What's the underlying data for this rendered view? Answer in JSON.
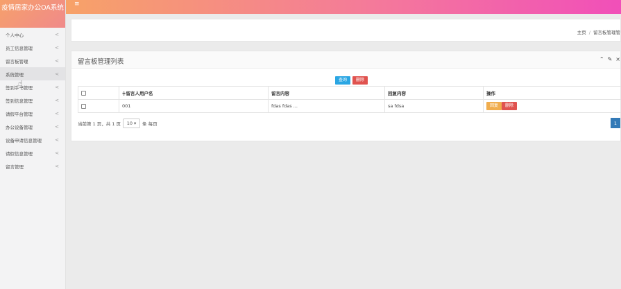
{
  "app": {
    "title": "疫情居家办公OA系统"
  },
  "sidebar": {
    "items": [
      {
        "label": "个人中心"
      },
      {
        "label": "员工信息管理"
      },
      {
        "label": "留言板管理"
      },
      {
        "label": "系统管理"
      },
      {
        "label": "签到手书管理"
      },
      {
        "label": "签到信息管理"
      },
      {
        "label": "请假平台管理"
      },
      {
        "label": "办公设备管理"
      },
      {
        "label": "设备申请信息管理"
      },
      {
        "label": "请假信息管理"
      },
      {
        "label": "留言管理"
      }
    ],
    "active_index": 3,
    "chevron": "<"
  },
  "topbar": {
    "menu_icon": "≡"
  },
  "breadcrumb": {
    "home": "主页",
    "sep": "/",
    "current": "留言板管理管"
  },
  "panel": {
    "title": "留言板管理列表",
    "tools": {
      "collapse": "⌃",
      "wrench": "✎",
      "close": "×"
    },
    "search_button": "查询",
    "delete_button": "删除"
  },
  "table": {
    "headers": [
      "≑留言人用户名",
      "留言内容",
      "回复内容",
      "操作"
    ],
    "rows": [
      {
        "username": "001",
        "content": "fdas fdas ...",
        "reply": "sa fdsa",
        "reply_btn": "回复",
        "delete_btn": "删除"
      }
    ]
  },
  "pager": {
    "summary": "当前第 1 页，共 1 页",
    "page_size": "10",
    "per_page_label": "条 每页",
    "current_page": "1"
  },
  "colors": {
    "topbar_gradient": [
      "#f7a268",
      "#f47a9a",
      "#f14fb9"
    ],
    "primary": "#2aa6e3",
    "danger": "#e0534f",
    "warning": "#f0ad4e",
    "page_active": "#337ab7"
  }
}
